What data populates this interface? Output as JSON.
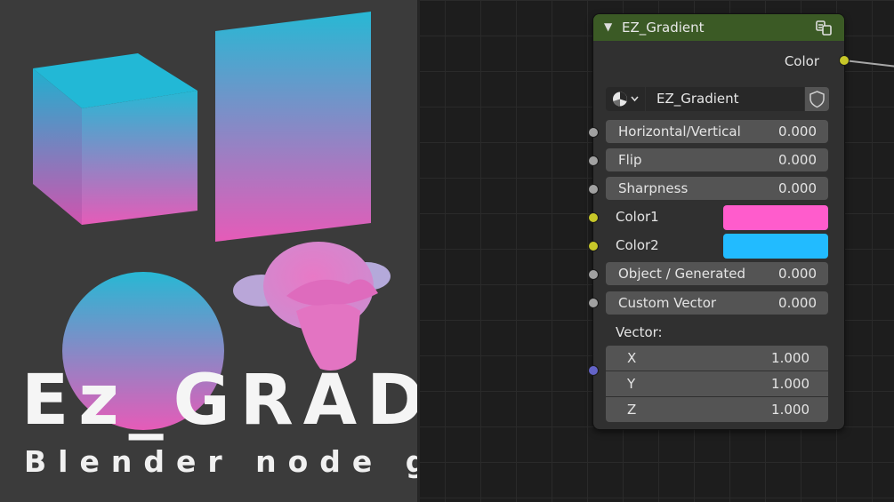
{
  "banner": {
    "title": "Ez_GRADIENT",
    "subtitle": "Blender node group"
  },
  "colors": {
    "gradient_top": "#27b8d4",
    "gradient_bottom": "#e65bb8",
    "node_header": "#3b5a25",
    "color1": "#ff5ccc",
    "color2": "#22bbff",
    "socket_yellow": "#c7c729",
    "socket_gray": "#a1a1a1",
    "socket_purple": "#6363c7"
  },
  "node": {
    "title": "EZ_Gradient",
    "output_label": "Color",
    "group_selector": {
      "icon": "node-tree-icon",
      "name": "EZ_Gradient",
      "fake_user_icon": "shield-icon"
    },
    "inputs": [
      {
        "label": "Horizontal/Vertical",
        "value": "0.000"
      },
      {
        "label": "Flip",
        "value": "0.000"
      },
      {
        "label": "Sharpness",
        "value": "0.000"
      },
      {
        "label": "Color1",
        "color": "#ff5ccc"
      },
      {
        "label": "Color2",
        "color": "#22bbff"
      },
      {
        "label": "Object / Generated",
        "value": "0.000"
      },
      {
        "label": "Custom Vector",
        "value": "0.000"
      }
    ],
    "vector": {
      "label": "Vector:",
      "components": [
        {
          "label": "X",
          "value": "1.000"
        },
        {
          "label": "Y",
          "value": "1.000"
        },
        {
          "label": "Z",
          "value": "1.000"
        }
      ]
    }
  }
}
